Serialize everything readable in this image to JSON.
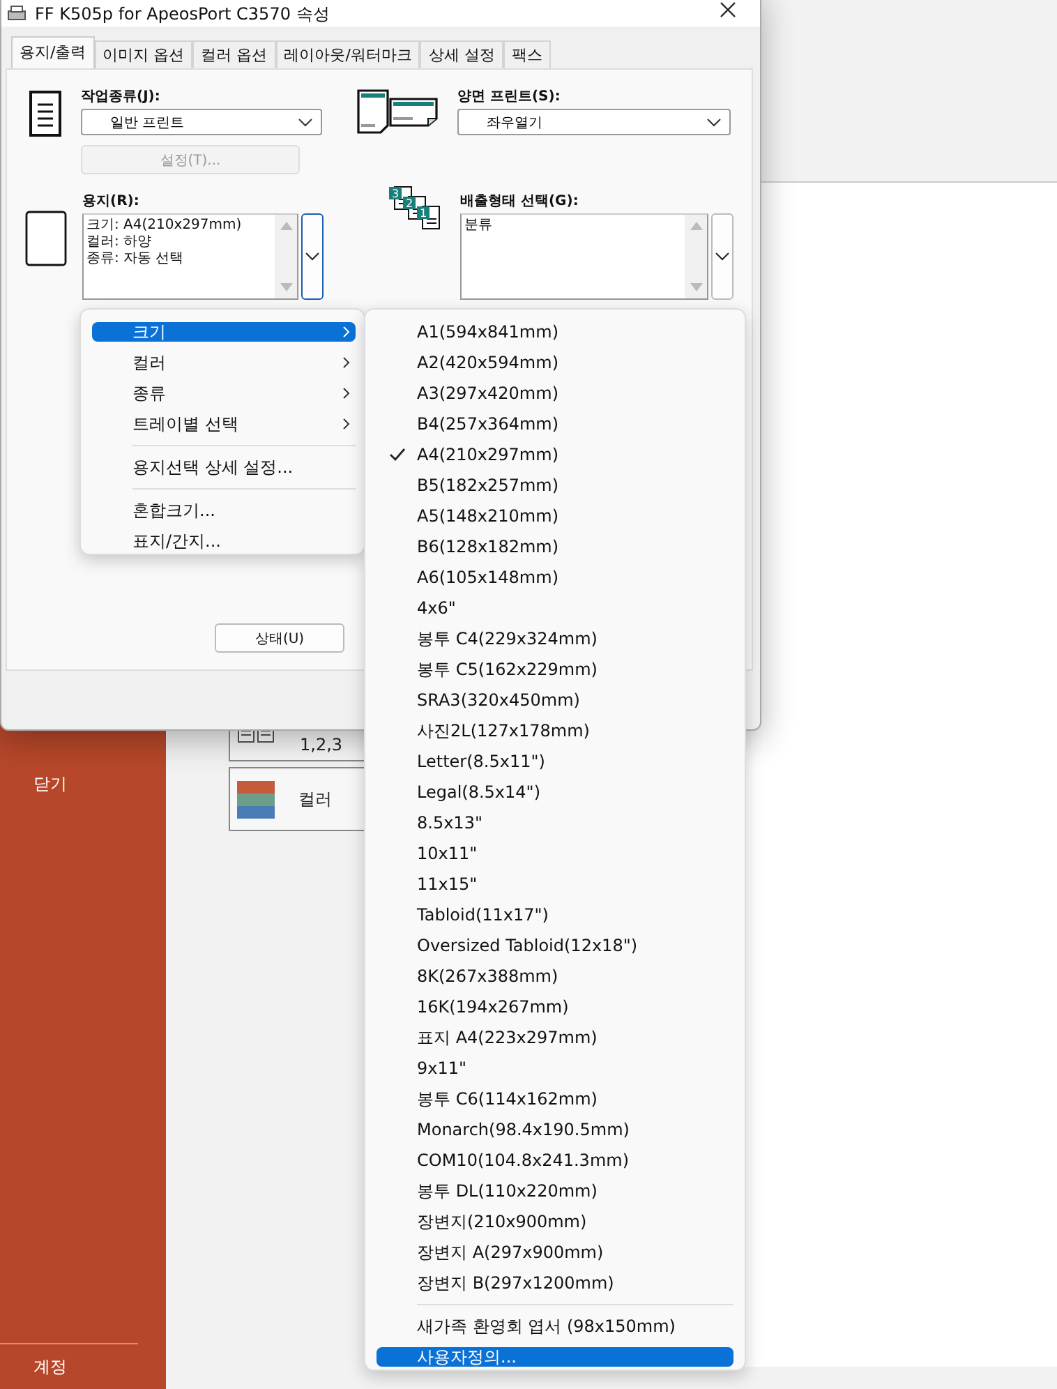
{
  "backstage": {
    "sidebar_items": [
      {
        "label": "닫기",
        "selected": false
      },
      {
        "label": "계정",
        "selected": false
      }
    ],
    "cards": [
      {
        "kind": "collate",
        "label": "1,2,3"
      },
      {
        "kind": "color",
        "label": "컬러"
      }
    ]
  },
  "dialog": {
    "title": "FF K505p for ApeosPort C3570 속성",
    "tabs": [
      {
        "label": "용지/출력",
        "selected": true
      },
      {
        "label": "이미지 옵션",
        "selected": false
      },
      {
        "label": "컬러 옵션",
        "selected": false
      },
      {
        "label": "레이아웃/워터마크",
        "selected": false
      },
      {
        "label": "상세 설정",
        "selected": false
      },
      {
        "label": "팩스",
        "selected": false
      }
    ],
    "job_type": {
      "label": "작업종류(J):",
      "value": "일반 프린트"
    },
    "settings_button": {
      "label": "설정(T)...",
      "disabled": true
    },
    "duplex": {
      "label": "양면 프린트(S):",
      "value": "좌우열기"
    },
    "paper": {
      "label": "용지(R):",
      "lines": [
        "크기: A4(210x297mm)",
        "컬러: 하양",
        "종류: 자동 선택"
      ]
    },
    "output": {
      "label": "배출형태 선택(G):",
      "lines": [
        "분류"
      ],
      "icon_labels": [
        "3",
        "2",
        "1"
      ]
    },
    "status_button": {
      "label": "상태(U)"
    }
  },
  "context_menu": [
    {
      "kind": "submenu",
      "label": "크기",
      "selected": true
    },
    {
      "kind": "submenu",
      "label": "컬러",
      "selected": false
    },
    {
      "kind": "submenu",
      "label": "종류",
      "selected": false
    },
    {
      "kind": "submenu",
      "label": "트레이별 선택",
      "selected": false
    },
    {
      "kind": "separator"
    },
    {
      "kind": "item",
      "label": "용지선택 상세 설정...",
      "selected": false
    },
    {
      "kind": "separator"
    },
    {
      "kind": "item",
      "label": "혼합크기...",
      "selected": false
    },
    {
      "kind": "item",
      "label": "표지/간지...",
      "selected": false
    }
  ],
  "size_menu": [
    {
      "kind": "item",
      "label": "A1(594x841mm)",
      "checked": false,
      "selected": false
    },
    {
      "kind": "item",
      "label": "A2(420x594mm)",
      "checked": false,
      "selected": false
    },
    {
      "kind": "item",
      "label": "A3(297x420mm)",
      "checked": false,
      "selected": false
    },
    {
      "kind": "item",
      "label": "B4(257x364mm)",
      "checked": false,
      "selected": false
    },
    {
      "kind": "item",
      "label": "A4(210x297mm)",
      "checked": true,
      "selected": false
    },
    {
      "kind": "item",
      "label": "B5(182x257mm)",
      "checked": false,
      "selected": false
    },
    {
      "kind": "item",
      "label": "A5(148x210mm)",
      "checked": false,
      "selected": false
    },
    {
      "kind": "item",
      "label": "B6(128x182mm)",
      "checked": false,
      "selected": false
    },
    {
      "kind": "item",
      "label": "A6(105x148mm)",
      "checked": false,
      "selected": false
    },
    {
      "kind": "item",
      "label": "4x6\"",
      "checked": false,
      "selected": false
    },
    {
      "kind": "item",
      "label": "봉투 C4(229x324mm)",
      "checked": false,
      "selected": false
    },
    {
      "kind": "item",
      "label": "봉투 C5(162x229mm)",
      "checked": false,
      "selected": false
    },
    {
      "kind": "item",
      "label": "SRA3(320x450mm)",
      "checked": false,
      "selected": false
    },
    {
      "kind": "item",
      "label": "사진2L(127x178mm)",
      "checked": false,
      "selected": false
    },
    {
      "kind": "item",
      "label": "Letter(8.5x11\")",
      "checked": false,
      "selected": false
    },
    {
      "kind": "item",
      "label": "Legal(8.5x14\")",
      "checked": false,
      "selected": false
    },
    {
      "kind": "item",
      "label": "8.5x13\"",
      "checked": false,
      "selected": false
    },
    {
      "kind": "item",
      "label": "10x11\"",
      "checked": false,
      "selected": false
    },
    {
      "kind": "item",
      "label": "11x15\"",
      "checked": false,
      "selected": false
    },
    {
      "kind": "item",
      "label": "Tabloid(11x17\")",
      "checked": false,
      "selected": false
    },
    {
      "kind": "item",
      "label": "Oversized Tabloid(12x18\")",
      "checked": false,
      "selected": false
    },
    {
      "kind": "item",
      "label": "8K(267x388mm)",
      "checked": false,
      "selected": false
    },
    {
      "kind": "item",
      "label": "16K(194x267mm)",
      "checked": false,
      "selected": false
    },
    {
      "kind": "item",
      "label": "표지 A4(223x297mm)",
      "checked": false,
      "selected": false
    },
    {
      "kind": "item",
      "label": "9x11\"",
      "checked": false,
      "selected": false
    },
    {
      "kind": "item",
      "label": "봉투 C6(114x162mm)",
      "checked": false,
      "selected": false
    },
    {
      "kind": "item",
      "label": "Monarch(98.4x190.5mm)",
      "checked": false,
      "selected": false
    },
    {
      "kind": "item",
      "label": "COM10(104.8x241.3mm)",
      "checked": false,
      "selected": false
    },
    {
      "kind": "item",
      "label": "봉투 DL(110x220mm)",
      "checked": false,
      "selected": false
    },
    {
      "kind": "item",
      "label": "장변지(210x900mm)",
      "checked": false,
      "selected": false
    },
    {
      "kind": "item",
      "label": "장변지 A(297x900mm)",
      "checked": false,
      "selected": false
    },
    {
      "kind": "item",
      "label": "장변지 B(297x1200mm)",
      "checked": false,
      "selected": false
    },
    {
      "kind": "separator"
    },
    {
      "kind": "item",
      "label": "새가족 환영회 엽서 (98x150mm)",
      "checked": false,
      "selected": false
    },
    {
      "kind": "item",
      "label": "사용자정의...",
      "checked": false,
      "selected": true
    }
  ]
}
